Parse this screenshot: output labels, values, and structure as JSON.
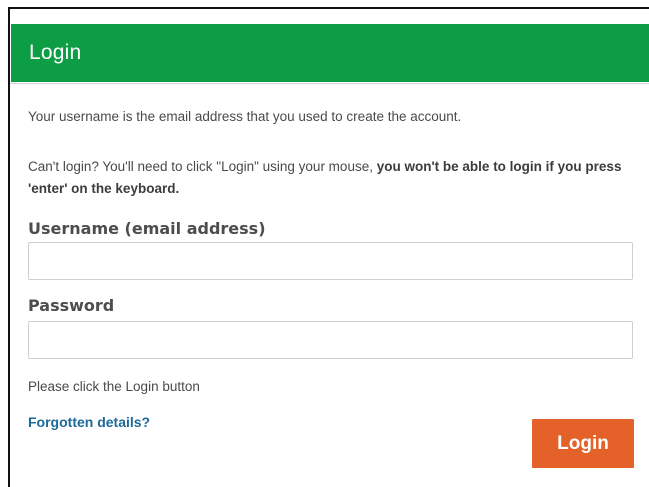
{
  "panel": {
    "title": "Login",
    "header_color": "#0d9d45"
  },
  "info": {
    "line1": "Your username is the email address that you used to create the account.",
    "line2_prefix": "Can't login? You'll need to click \"Login\" using your mouse, ",
    "line2_bold": "you won't be able to login if you press 'enter' on the keyboard."
  },
  "form": {
    "username_label": "Username (email address)",
    "username_value": "",
    "password_label": "Password",
    "password_value": "",
    "hint": "Please click the Login button",
    "forgot_label": "Forgotten details?",
    "login_label": "Login",
    "login_color": "#e4622a"
  }
}
